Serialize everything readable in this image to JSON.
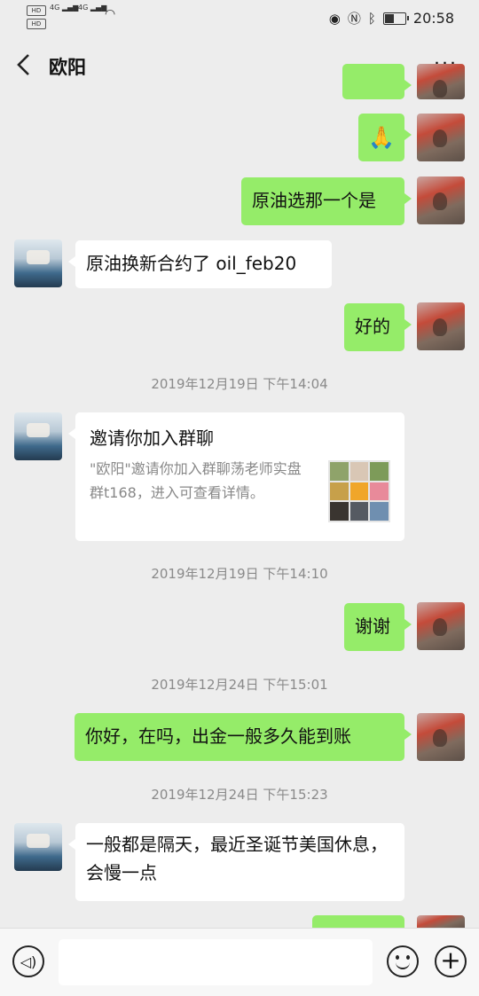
{
  "status_bar": {
    "hd1": "HD",
    "hd2": "HD",
    "net1": "4G",
    "net2": "4G",
    "time": "20:58"
  },
  "header": {
    "title": "欧阳",
    "more": "···"
  },
  "messages": {
    "m1_emoji": "🙏",
    "m2": "原油选那一个是",
    "m3": "原油换新合约了 oil_feb20",
    "m4": "好的",
    "ts1": "2019年12月19日 下午14:04",
    "card": {
      "title": "邀请你加入群聊",
      "desc": "\"欧阳\"邀请你加入群聊荡老师实盘群t168，进入可查看详情。"
    },
    "ts2": "2019年12月19日 下午14:10",
    "m5": "谢谢",
    "ts3": "2019年12月24日 下午15:01",
    "m6": "你好，在吗，出金一般多久能到账",
    "ts4": "2019年12月24日 下午15:23",
    "m7": "一般都是隔天，最近圣诞节美国休息，会慢一点"
  },
  "input_bar": {
    "value": "",
    "plus": "+",
    "voice": "◁)"
  },
  "colors": {
    "my_bubble": "#95ec69",
    "other_bubble": "#ffffff",
    "background": "#ededed"
  }
}
